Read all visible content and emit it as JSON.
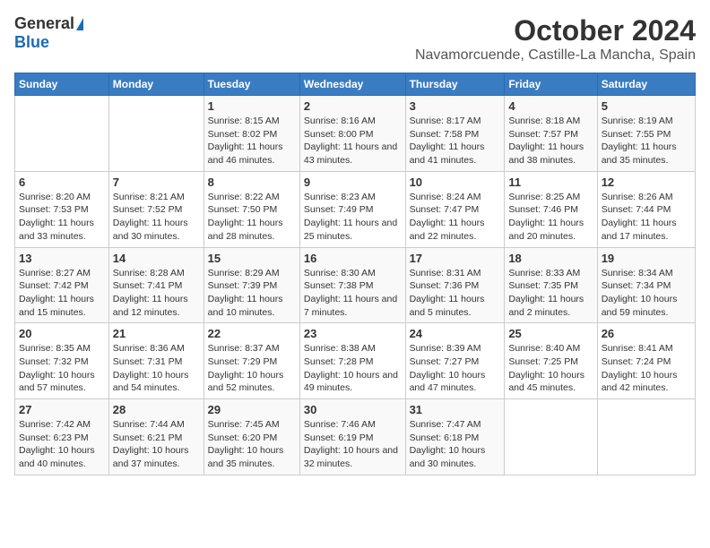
{
  "logo": {
    "general": "General",
    "blue": "Blue"
  },
  "title": "October 2024",
  "subtitle": "Navamorcuende, Castille-La Mancha, Spain",
  "days_of_week": [
    "Sunday",
    "Monday",
    "Tuesday",
    "Wednesday",
    "Thursday",
    "Friday",
    "Saturday"
  ],
  "weeks": [
    [
      {
        "day": "",
        "info": ""
      },
      {
        "day": "",
        "info": ""
      },
      {
        "day": "1",
        "info": "Sunrise: 8:15 AM\nSunset: 8:02 PM\nDaylight: 11 hours and 46 minutes."
      },
      {
        "day": "2",
        "info": "Sunrise: 8:16 AM\nSunset: 8:00 PM\nDaylight: 11 hours and 43 minutes."
      },
      {
        "day": "3",
        "info": "Sunrise: 8:17 AM\nSunset: 7:58 PM\nDaylight: 11 hours and 41 minutes."
      },
      {
        "day": "4",
        "info": "Sunrise: 8:18 AM\nSunset: 7:57 PM\nDaylight: 11 hours and 38 minutes."
      },
      {
        "day": "5",
        "info": "Sunrise: 8:19 AM\nSunset: 7:55 PM\nDaylight: 11 hours and 35 minutes."
      }
    ],
    [
      {
        "day": "6",
        "info": "Sunrise: 8:20 AM\nSunset: 7:53 PM\nDaylight: 11 hours and 33 minutes."
      },
      {
        "day": "7",
        "info": "Sunrise: 8:21 AM\nSunset: 7:52 PM\nDaylight: 11 hours and 30 minutes."
      },
      {
        "day": "8",
        "info": "Sunrise: 8:22 AM\nSunset: 7:50 PM\nDaylight: 11 hours and 28 minutes."
      },
      {
        "day": "9",
        "info": "Sunrise: 8:23 AM\nSunset: 7:49 PM\nDaylight: 11 hours and 25 minutes."
      },
      {
        "day": "10",
        "info": "Sunrise: 8:24 AM\nSunset: 7:47 PM\nDaylight: 11 hours and 22 minutes."
      },
      {
        "day": "11",
        "info": "Sunrise: 8:25 AM\nSunset: 7:46 PM\nDaylight: 11 hours and 20 minutes."
      },
      {
        "day": "12",
        "info": "Sunrise: 8:26 AM\nSunset: 7:44 PM\nDaylight: 11 hours and 17 minutes."
      }
    ],
    [
      {
        "day": "13",
        "info": "Sunrise: 8:27 AM\nSunset: 7:42 PM\nDaylight: 11 hours and 15 minutes."
      },
      {
        "day": "14",
        "info": "Sunrise: 8:28 AM\nSunset: 7:41 PM\nDaylight: 11 hours and 12 minutes."
      },
      {
        "day": "15",
        "info": "Sunrise: 8:29 AM\nSunset: 7:39 PM\nDaylight: 11 hours and 10 minutes."
      },
      {
        "day": "16",
        "info": "Sunrise: 8:30 AM\nSunset: 7:38 PM\nDaylight: 11 hours and 7 minutes."
      },
      {
        "day": "17",
        "info": "Sunrise: 8:31 AM\nSunset: 7:36 PM\nDaylight: 11 hours and 5 minutes."
      },
      {
        "day": "18",
        "info": "Sunrise: 8:33 AM\nSunset: 7:35 PM\nDaylight: 11 hours and 2 minutes."
      },
      {
        "day": "19",
        "info": "Sunrise: 8:34 AM\nSunset: 7:34 PM\nDaylight: 10 hours and 59 minutes."
      }
    ],
    [
      {
        "day": "20",
        "info": "Sunrise: 8:35 AM\nSunset: 7:32 PM\nDaylight: 10 hours and 57 minutes."
      },
      {
        "day": "21",
        "info": "Sunrise: 8:36 AM\nSunset: 7:31 PM\nDaylight: 10 hours and 54 minutes."
      },
      {
        "day": "22",
        "info": "Sunrise: 8:37 AM\nSunset: 7:29 PM\nDaylight: 10 hours and 52 minutes."
      },
      {
        "day": "23",
        "info": "Sunrise: 8:38 AM\nSunset: 7:28 PM\nDaylight: 10 hours and 49 minutes."
      },
      {
        "day": "24",
        "info": "Sunrise: 8:39 AM\nSunset: 7:27 PM\nDaylight: 10 hours and 47 minutes."
      },
      {
        "day": "25",
        "info": "Sunrise: 8:40 AM\nSunset: 7:25 PM\nDaylight: 10 hours and 45 minutes."
      },
      {
        "day": "26",
        "info": "Sunrise: 8:41 AM\nSunset: 7:24 PM\nDaylight: 10 hours and 42 minutes."
      }
    ],
    [
      {
        "day": "27",
        "info": "Sunrise: 7:42 AM\nSunset: 6:23 PM\nDaylight: 10 hours and 40 minutes."
      },
      {
        "day": "28",
        "info": "Sunrise: 7:44 AM\nSunset: 6:21 PM\nDaylight: 10 hours and 37 minutes."
      },
      {
        "day": "29",
        "info": "Sunrise: 7:45 AM\nSunset: 6:20 PM\nDaylight: 10 hours and 35 minutes."
      },
      {
        "day": "30",
        "info": "Sunrise: 7:46 AM\nSunset: 6:19 PM\nDaylight: 10 hours and 32 minutes."
      },
      {
        "day": "31",
        "info": "Sunrise: 7:47 AM\nSunset: 6:18 PM\nDaylight: 10 hours and 30 minutes."
      },
      {
        "day": "",
        "info": ""
      },
      {
        "day": "",
        "info": ""
      }
    ]
  ]
}
